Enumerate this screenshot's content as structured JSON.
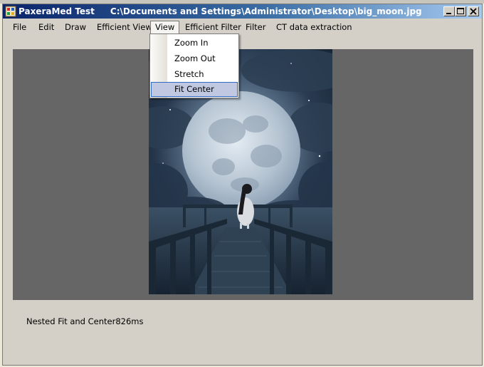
{
  "window": {
    "app_title": "PaxeraMed Test",
    "file_path": "C:\\Documents and Settings\\Administrator\\Desktop\\big_moon.jpg",
    "controls": [
      "minimize-icon",
      "maximize-icon",
      "close-icon"
    ]
  },
  "menubar": {
    "items": [
      {
        "label": "File"
      },
      {
        "label": "Edit"
      },
      {
        "label": "Draw"
      },
      {
        "label": "Efficient View"
      },
      {
        "label": "View"
      },
      {
        "label": "Efficient Filter"
      },
      {
        "label": "Filter"
      },
      {
        "label": "CT data extraction"
      }
    ],
    "open_menu": "View"
  },
  "view_menu": {
    "items": [
      {
        "label": "Zoom In"
      },
      {
        "label": "Zoom Out"
      },
      {
        "label": "Stretch"
      },
      {
        "label": "Fit  Center"
      }
    ],
    "highlighted": "Fit  Center"
  },
  "image": {
    "description_icon": "moon-pier-photo"
  },
  "status": {
    "text": "Nested Fit and Center826ms"
  },
  "colors": {
    "canvas_bg": "#666666",
    "window_bg": "#d4d0c8",
    "menu_highlight": "#c1c9e2",
    "menu_highlight_border": "#316ac5"
  }
}
